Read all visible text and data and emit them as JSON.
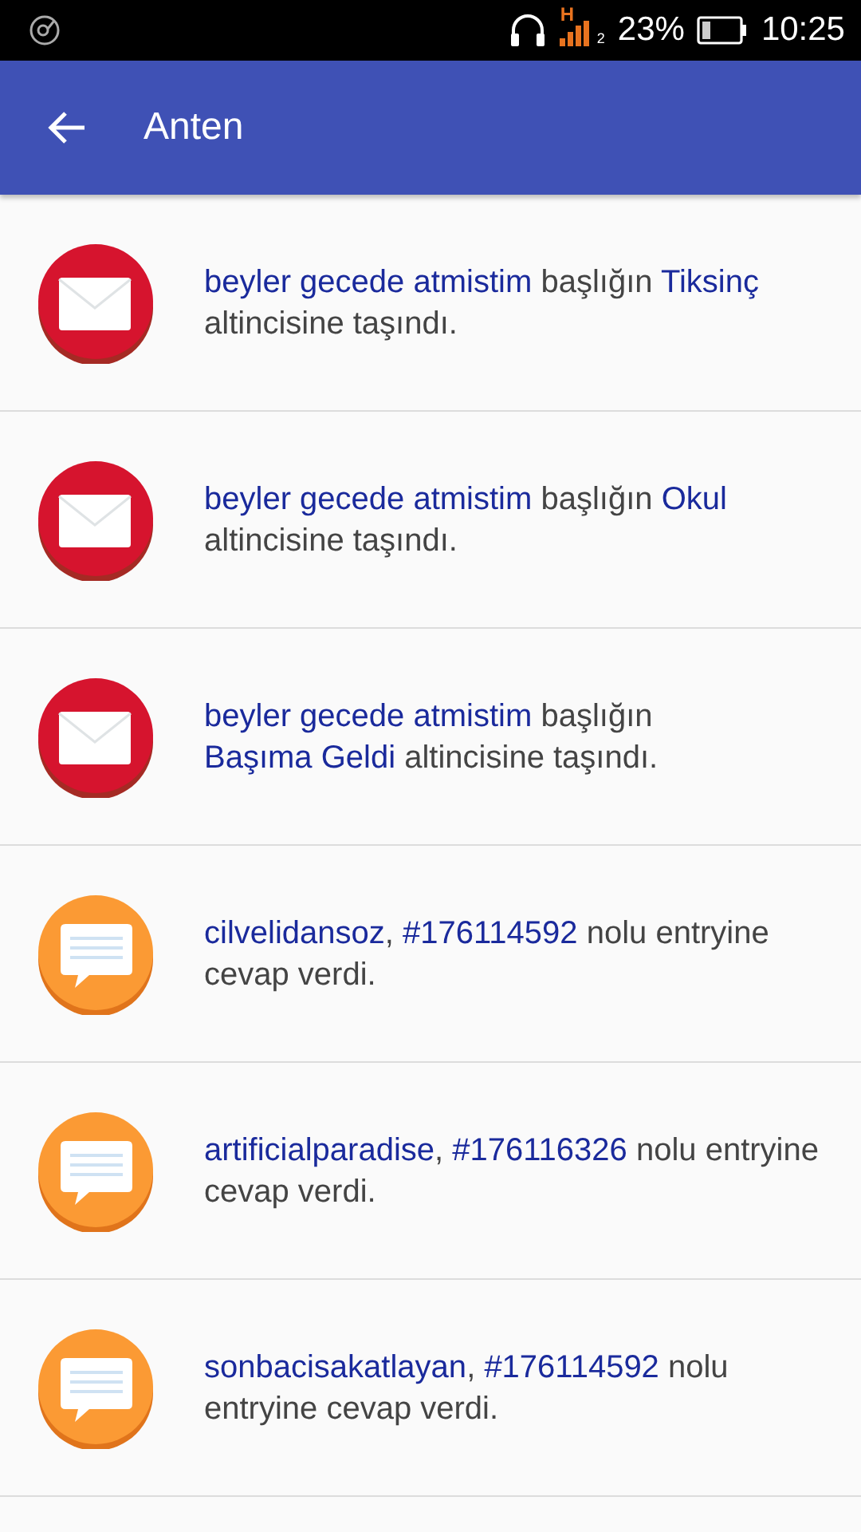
{
  "status_bar": {
    "network_type": "H",
    "sim": "2",
    "battery": "23%",
    "time": "10:25"
  },
  "app_bar": {
    "title": "Anten"
  },
  "notifications": [
    {
      "kind": "moved",
      "segments": [
        {
          "kind": "link",
          "text": "beyler gecede atmistim"
        },
        {
          "kind": "plain",
          "text": " başlığın "
        },
        {
          "kind": "link",
          "text": "Tiksinç"
        },
        {
          "kind": "plain",
          "text": " altincisine taşındı."
        }
      ]
    },
    {
      "kind": "moved",
      "segments": [
        {
          "kind": "link",
          "text": "beyler gecede atmistim"
        },
        {
          "kind": "plain",
          "text": " başlığın "
        },
        {
          "kind": "link",
          "text": "Okul"
        },
        {
          "kind": "plain",
          "text": " altincisine taşındı."
        }
      ]
    },
    {
      "kind": "moved",
      "segments": [
        {
          "kind": "link",
          "text": "beyler gecede atmistim"
        },
        {
          "kind": "plain",
          "text": " başlığın "
        },
        {
          "kind": "link",
          "text": "Başıma Geldi"
        },
        {
          "kind": "plain",
          "text": " altincisine taşındı."
        }
      ]
    },
    {
      "kind": "reply",
      "segments": [
        {
          "kind": "link",
          "text": "cilvelidansoz"
        },
        {
          "kind": "plain",
          "text": ", "
        },
        {
          "kind": "link",
          "text": "#176114592"
        },
        {
          "kind": "plain",
          "text": " nolu entryine cevap verdi."
        }
      ]
    },
    {
      "kind": "reply",
      "segments": [
        {
          "kind": "link",
          "text": "artificialparadise"
        },
        {
          "kind": "plain",
          "text": ", "
        },
        {
          "kind": "link",
          "text": "#176116326"
        },
        {
          "kind": "plain",
          "text": " nolu entryine cevap verdi."
        }
      ]
    },
    {
      "kind": "reply",
      "segments": [
        {
          "kind": "link",
          "text": "sonbacisakatlayan"
        },
        {
          "kind": "plain",
          "text": ", "
        },
        {
          "kind": "link",
          "text": "#176114592"
        },
        {
          "kind": "plain",
          "text": " nolu entryine cevap verdi."
        }
      ]
    }
  ]
}
